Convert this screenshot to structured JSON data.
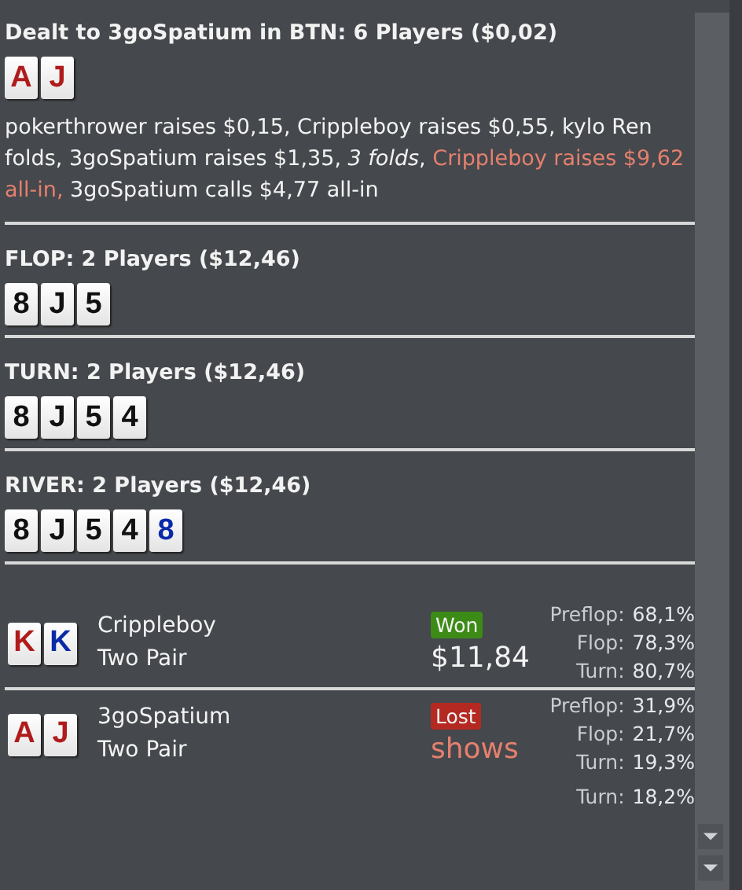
{
  "preflop": {
    "title": "Dealt to 3goSpatium in BTN: 6 Players ($0,02)",
    "cards": [
      {
        "rank": "A",
        "color": "#b01c1c"
      },
      {
        "rank": "J",
        "color": "#b01c1c"
      }
    ],
    "actions": [
      {
        "kind": "normal",
        "text": "pokerthrower raises $0,15, Crippleboy raises $0,55, kylo Ren folds, 3goSpatium raises $1,35, "
      },
      {
        "kind": "italic",
        "text": "3 folds"
      },
      {
        "kind": "normal",
        "text": ", "
      },
      {
        "kind": "allin",
        "text": "Crippleboy raises $9,62 all-in,"
      },
      {
        "kind": "normal",
        "text": " 3goSpatium calls $4,77 all-in"
      }
    ]
  },
  "streets": [
    {
      "title": "FLOP: 2 Players ($12,46)",
      "cards": [
        {
          "rank": "8",
          "color": "#111111"
        },
        {
          "rank": "J",
          "color": "#111111"
        },
        {
          "rank": "5",
          "color": "#111111"
        }
      ]
    },
    {
      "title": "TURN: 2 Players ($12,46)",
      "cards": [
        {
          "rank": "8",
          "color": "#111111"
        },
        {
          "rank": "J",
          "color": "#111111"
        },
        {
          "rank": "5",
          "color": "#111111"
        },
        {
          "rank": "4",
          "color": "#111111"
        }
      ]
    },
    {
      "title": "RIVER: 2 Players ($12,46)",
      "cards": [
        {
          "rank": "8",
          "color": "#111111"
        },
        {
          "rank": "J",
          "color": "#111111"
        },
        {
          "rank": "5",
          "color": "#111111"
        },
        {
          "rank": "4",
          "color": "#111111"
        },
        {
          "rank": "8",
          "color": "#0a2aa8"
        }
      ]
    }
  ],
  "players": [
    {
      "name": "Crippleboy",
      "hand": "Two Pair",
      "cards": [
        {
          "rank": "K",
          "color": "#b01c1c"
        },
        {
          "rank": "K",
          "color": "#0a2aa8"
        }
      ],
      "result": {
        "kind": "won",
        "label": "Won"
      },
      "amount": {
        "kind": "money",
        "text": "$11,84"
      },
      "stats": [
        {
          "label": "Preflop:",
          "value": "68,1%"
        },
        {
          "label": "Flop:",
          "value": "78,3%"
        },
        {
          "label": "Turn:",
          "value": "80,7%"
        }
      ]
    },
    {
      "name": "3goSpatium",
      "hand": "Two Pair",
      "cards": [
        {
          "rank": "A",
          "color": "#b01c1c"
        },
        {
          "rank": "J",
          "color": "#b01c1c"
        }
      ],
      "result": {
        "kind": "lost",
        "label": "Lost"
      },
      "amount": {
        "kind": "shows",
        "text": "shows"
      },
      "stats": [
        {
          "label": "Preflop:",
          "value": "31,9%"
        },
        {
          "label": "Flop:",
          "value": "21,7%"
        },
        {
          "label": "Turn:",
          "value": "19,3%"
        }
      ]
    }
  ],
  "overlap_stat": {
    "label": "Turn:",
    "value": "18,2%"
  }
}
